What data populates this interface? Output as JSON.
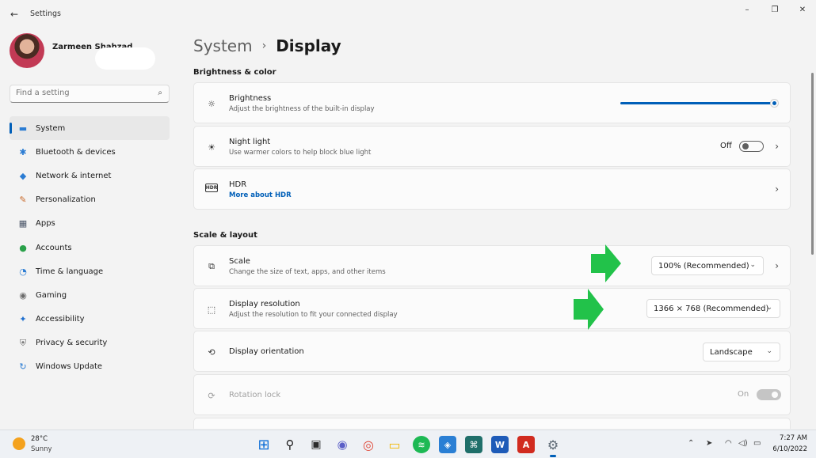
{
  "window": {
    "title": "Settings",
    "back_icon": "←",
    "minimize_icon": "–",
    "restore_icon": "❐",
    "close_icon": "✕"
  },
  "profile": {
    "name": "Zarmeen Shahzad"
  },
  "search": {
    "placeholder": "Find a setting",
    "icon": "⌕"
  },
  "sidebar": {
    "items": [
      {
        "label": "System",
        "icon": "▬",
        "color": "#2b7cd3"
      },
      {
        "label": "Bluetooth & devices",
        "icon": "✱",
        "color": "#2b7cd3"
      },
      {
        "label": "Network & internet",
        "icon": "◆",
        "color": "#2b7cd3"
      },
      {
        "label": "Personalization",
        "icon": "✎",
        "color": "#c96a2b"
      },
      {
        "label": "Apps",
        "icon": "▦",
        "color": "#4a5568"
      },
      {
        "label": "Accounts",
        "icon": "●",
        "color": "#2aa14a"
      },
      {
        "label": "Time & language",
        "icon": "◔",
        "color": "#2b7cd3"
      },
      {
        "label": "Gaming",
        "icon": "◉",
        "color": "#6b6b6b"
      },
      {
        "label": "Accessibility",
        "icon": "✦",
        "color": "#1f6fcf"
      },
      {
        "label": "Privacy & security",
        "icon": "⛨",
        "color": "#6b6b6b"
      },
      {
        "label": "Windows Update",
        "icon": "↻",
        "color": "#2b7cd3"
      }
    ],
    "active_index": 0
  },
  "breadcrumb": {
    "parent": "System",
    "separator": "›",
    "current": "Display"
  },
  "sections": {
    "brightness_color": "Brightness & color",
    "scale_layout": "Scale & layout"
  },
  "cards": {
    "brightness": {
      "title": "Brightness",
      "subtitle": "Adjust the brightness of the built-in display",
      "icon": "☼",
      "level_percent": 100
    },
    "night_light": {
      "title": "Night light",
      "subtitle": "Use warmer colors to help block blue light",
      "icon": "☀",
      "toggle_label": "Off",
      "chevron": "›"
    },
    "hdr": {
      "title": "HDR",
      "link": "More about HDR",
      "icon": "HDR",
      "chevron": "›"
    },
    "scale": {
      "title": "Scale",
      "subtitle": "Change the size of text, apps, and other items",
      "icon": "⧉",
      "value": "100% (Recommended)",
      "chevron": "›",
      "dd_chevron": "⌄"
    },
    "resolution": {
      "title": "Display resolution",
      "subtitle": "Adjust the resolution to fit your connected display",
      "icon": "⬚",
      "value": "1366 × 768 (Recommended)",
      "dd_chevron": "⌄"
    },
    "orientation": {
      "title": "Display orientation",
      "icon": "⟲",
      "value": "Landscape",
      "dd_chevron": "⌄"
    },
    "rotation_lock": {
      "title": "Rotation lock",
      "icon": "⟳",
      "toggle_label": "On"
    }
  },
  "annotation": {
    "arrow_color": "#22c24a"
  },
  "taskbar": {
    "weather_temp": "28°C",
    "weather_desc": "Sunny",
    "apps": [
      {
        "name": "start",
        "glyph": "⊞",
        "color": "#0a6cd6"
      },
      {
        "name": "search",
        "glyph": "⚲",
        "color": "#1a1a1a"
      },
      {
        "name": "task-view",
        "glyph": "▣",
        "color": "#2b2b2b"
      },
      {
        "name": "teams-chat",
        "glyph": "◉",
        "color": "#5b5fc7"
      },
      {
        "name": "chrome",
        "glyph": "◎",
        "color": "#e04a3a"
      },
      {
        "name": "file-explorer",
        "glyph": "▭",
        "color": "#f2b700"
      },
      {
        "name": "spotify",
        "glyph": "≋",
        "color": "#1db954"
      },
      {
        "name": "app-blue",
        "glyph": "◈",
        "color": "#2a7fd4"
      },
      {
        "name": "app-teal",
        "glyph": "⌘",
        "color": "#1f6f6a"
      },
      {
        "name": "word",
        "glyph": "W",
        "color": "#1e5bb8"
      },
      {
        "name": "acrobat",
        "glyph": "A",
        "color": "#d12b1f"
      },
      {
        "name": "settings",
        "glyph": "⚙",
        "color": "#5b6773"
      }
    ],
    "tray": {
      "chevron_up": "⌃",
      "location": "➤",
      "wifi": "◠",
      "volume": "◁)",
      "battery": "▭"
    },
    "time": "7:27 AM",
    "date": "6/10/2022"
  }
}
